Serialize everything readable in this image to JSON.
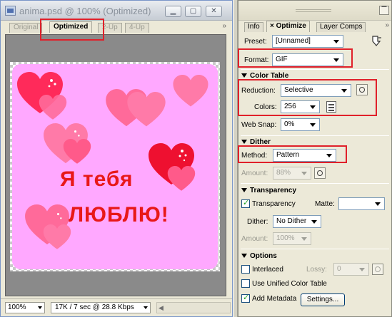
{
  "document": {
    "title": "anima.psd @ 100% (Optimized)",
    "tabs": [
      {
        "label": "Original"
      },
      {
        "label": "Optimized"
      },
      {
        "label": "2-Up"
      },
      {
        "label": "4-Up"
      }
    ],
    "image_text": {
      "line1": "Я  тебя",
      "line2": "ЛЮБЛЮ!"
    },
    "status": {
      "zoom": "100%",
      "info": "17K / 7 sec @ 28.8 Kbps"
    }
  },
  "panel": {
    "tabs": [
      {
        "label": "Info"
      },
      {
        "label": "Optimize"
      },
      {
        "label": "Layer Comps"
      }
    ],
    "preset": {
      "label": "Preset:",
      "value": "[Unnamed]"
    },
    "format": {
      "label": "Format:",
      "value": "GIF"
    },
    "color_table": {
      "title": "Color Table",
      "reduction_label": "Reduction:",
      "reduction_value": "Selective",
      "colors_label": "Colors:",
      "colors_value": "256",
      "websnap_label": "Web Snap:",
      "websnap_value": "0%"
    },
    "dither": {
      "title": "Dither",
      "method_label": "Method:",
      "method_value": "Pattern",
      "amount_label": "Amount:",
      "amount_value": "88%"
    },
    "transparency": {
      "title": "Transparency",
      "checkbox_label": "Transparency",
      "checked": true,
      "matte_label": "Matte:",
      "matte_value": "",
      "dither_label": "Dither:",
      "dither_value": "No Dither",
      "amount_label": "Amount:",
      "amount_value": "100%"
    },
    "options": {
      "title": "Options",
      "interlaced_label": "Interlaced",
      "lossy_label": "Lossy:",
      "lossy_value": "0",
      "unified_label": "Use Unified Color Table",
      "metadata_label": "Add Metadata",
      "settings_label": "Settings..."
    }
  },
  "colors": {
    "highlight_box": "#e0202a",
    "image_background": "#ffa8ff",
    "text_red": "#e81818"
  }
}
